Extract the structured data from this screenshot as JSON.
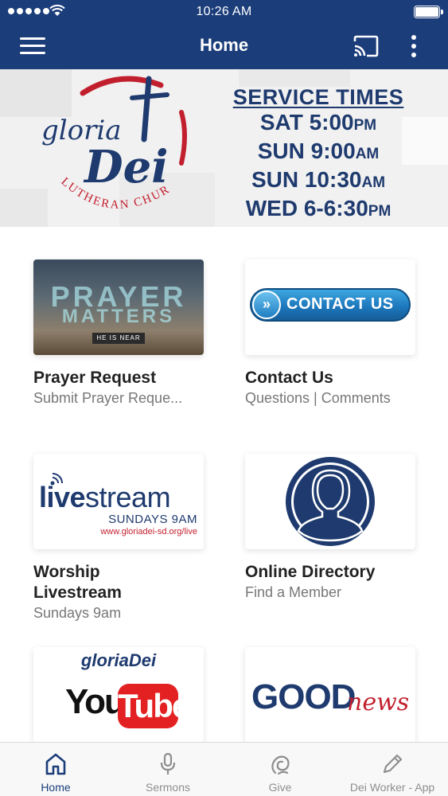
{
  "status_bar": {
    "time": "10:26 AM"
  },
  "app_bar": {
    "title": "Home"
  },
  "banner": {
    "logo_word_1": "gloria",
    "logo_word_2": "Dei",
    "logo_arc_text": "LUTHERAN CHURCH",
    "heading": "SERVICE TIMES",
    "times": [
      {
        "main": "SAT 5:00",
        "suffix": "PM"
      },
      {
        "main": "SUN 9:00",
        "suffix": "AM"
      },
      {
        "main": "SUN 10:30",
        "suffix": "AM"
      },
      {
        "main": "WED 6-6:30",
        "suffix": "PM"
      }
    ]
  },
  "cards": [
    {
      "title": "Prayer Request",
      "subtitle": "Submit Prayer Reque...",
      "image": {
        "word_1": "PRAYER",
        "word_2": "MATTERS",
        "banner": "HE IS NEAR"
      }
    },
    {
      "title": "Contact Us",
      "subtitle": "Questions | Comments",
      "image": {
        "button_text": "CONTACT US",
        "arrow": "»"
      }
    },
    {
      "title": "Worship Livestream",
      "subtitle": "Sundays 9am",
      "image": {
        "word_bold": "live",
        "word_rest": "stream",
        "sub": "SUNDAYS 9AM",
        "url": "www.gloriadei-sd.org/live"
      }
    },
    {
      "title": "Online Directory",
      "subtitle": "Find a Member",
      "image": {
        "icon": "people-icon"
      }
    },
    {
      "title": "",
      "subtitle": "",
      "image": {
        "brand": "gloriaDei",
        "you": "You",
        "tube": "Tube"
      }
    },
    {
      "title": "",
      "subtitle": "",
      "image": {
        "good": "GOOD",
        "news": "news"
      }
    }
  ],
  "tabs": [
    {
      "label": "Home",
      "icon": "home-icon",
      "active": true
    },
    {
      "label": "Sermons",
      "icon": "microphone-icon",
      "active": false
    },
    {
      "label": "Give",
      "icon": "give-icon",
      "active": false
    },
    {
      "label": "Dei Worker - App",
      "icon": "pencil-icon",
      "active": false
    }
  ],
  "colors": {
    "primary": "#1b3d7a",
    "accent_red": "#c21f2e",
    "tab_inactive": "#8e8e8e"
  }
}
